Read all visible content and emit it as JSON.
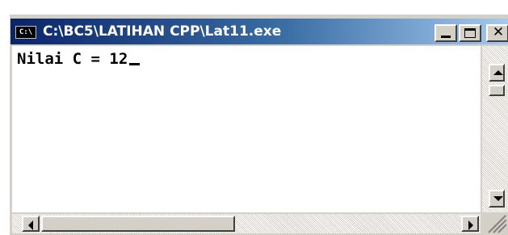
{
  "window": {
    "title": "C:\\BC5\\LATIHAN CPP\\Lat11.exe",
    "icon_text": "C:\\",
    "icon": "console-window-icon",
    "title_gradient": [
      "#0a246a",
      "#a6caf0"
    ]
  },
  "controls": {
    "minimize_icon": "minimize-icon",
    "maximize_icon": "maximize-icon",
    "close_icon": "close-icon",
    "close_glyph": "✕"
  },
  "console": {
    "line": "Nilai C = 12",
    "background": "#ffffff",
    "text_color": "#000000"
  },
  "scrollbars": {
    "up_icon": "arrow-up-icon",
    "down_icon": "arrow-down-icon",
    "left_icon": "arrow-left-icon",
    "right_icon": "arrow-right-icon"
  }
}
